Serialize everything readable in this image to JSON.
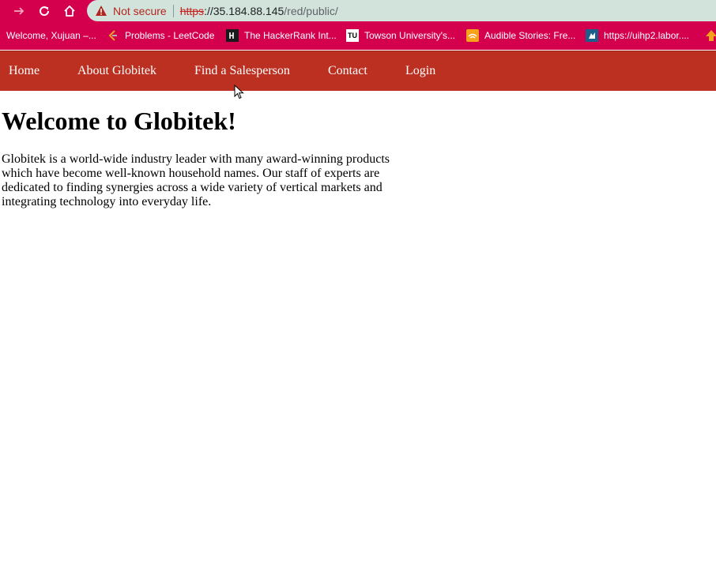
{
  "browser": {
    "security_label": "Not secure",
    "url": {
      "scheme": "https",
      "host_rest": "://35.184.88.145",
      "path": "/red/public/"
    }
  },
  "bookmarks": [
    {
      "label": "Welcome, Xujuan –...",
      "icon": "none"
    },
    {
      "label": "Problems - LeetCode",
      "icon": "leetcode-icon"
    },
    {
      "label": "The HackerRank Int...",
      "icon": "hackerrank-icon"
    },
    {
      "label": "Towson University's...",
      "icon": "towson-icon",
      "icon_text": "TU"
    },
    {
      "label": "Audible Stories: Fre...",
      "icon": "audible-icon"
    },
    {
      "label": "https://uihp2.labor....",
      "icon": "nys-icon"
    }
  ],
  "site_nav": {
    "items": [
      "Home",
      "About Globitek",
      "Find a Salesperson",
      "Contact",
      "Login"
    ]
  },
  "page": {
    "title": "Welcome to Globitek!",
    "body": "Globitek is a world-wide industry leader with many award-winning products which have become well-known household names. Our staff of experts are dedicated to finding synergies across a wide variety of vertical markets and integrating technology into everyday life."
  },
  "colors": {
    "browser_frame": "#d4004e",
    "omnibox": "#d2e3dc",
    "site_nav": "#bc3022"
  }
}
